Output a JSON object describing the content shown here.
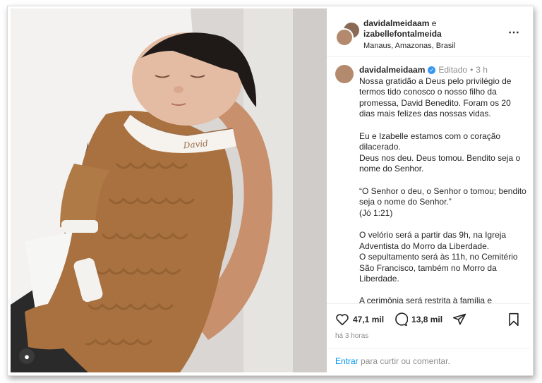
{
  "header": {
    "user1": "davidalmeidaam",
    "conjunction": "e",
    "user2": "izabellefontalmeida",
    "location": "Manaus, Amazonas, Brasil",
    "more_icon": "⋯"
  },
  "caption": {
    "username": "davidalmeidaam",
    "edited": "Editado",
    "separator": "•",
    "time": "3 h",
    "paragraphs": [
      "Nossa gratidão a Deus pelo privilégio de termos tido conosco o nosso filho da promessa, David Benedito. Foram os 20 dias mais felizes das nossas vidas.",
      "Eu e Izabelle estamos com o coração dilacerado.\nDeus nos deu. Deus tomou. Bendito seja o nome do Senhor.",
      "“O Senhor o deu, o Senhor o tomou; bendito seja o nome do Senhor.”\n(Jó 1:21)",
      "O velório será a partir das 9h, na Igreja Adventista do Morro da Liberdade.\nO sepultamento será às 11h, no Cemitério São Francisco, também no Morro da Liberdade.",
      "A cerimônia será restrita à família e"
    ]
  },
  "actions": {
    "likes": "47,1 mil",
    "comments": "13,8 mil",
    "time_ago": "há 3 horas"
  },
  "login": {
    "link": "Entrar",
    "rest": " para curtir ou comentar."
  },
  "photo": {
    "collar_text": "David"
  },
  "colors": {
    "link": "#0095f6",
    "verified": "#3897f0",
    "sweater": "#a9713f"
  }
}
